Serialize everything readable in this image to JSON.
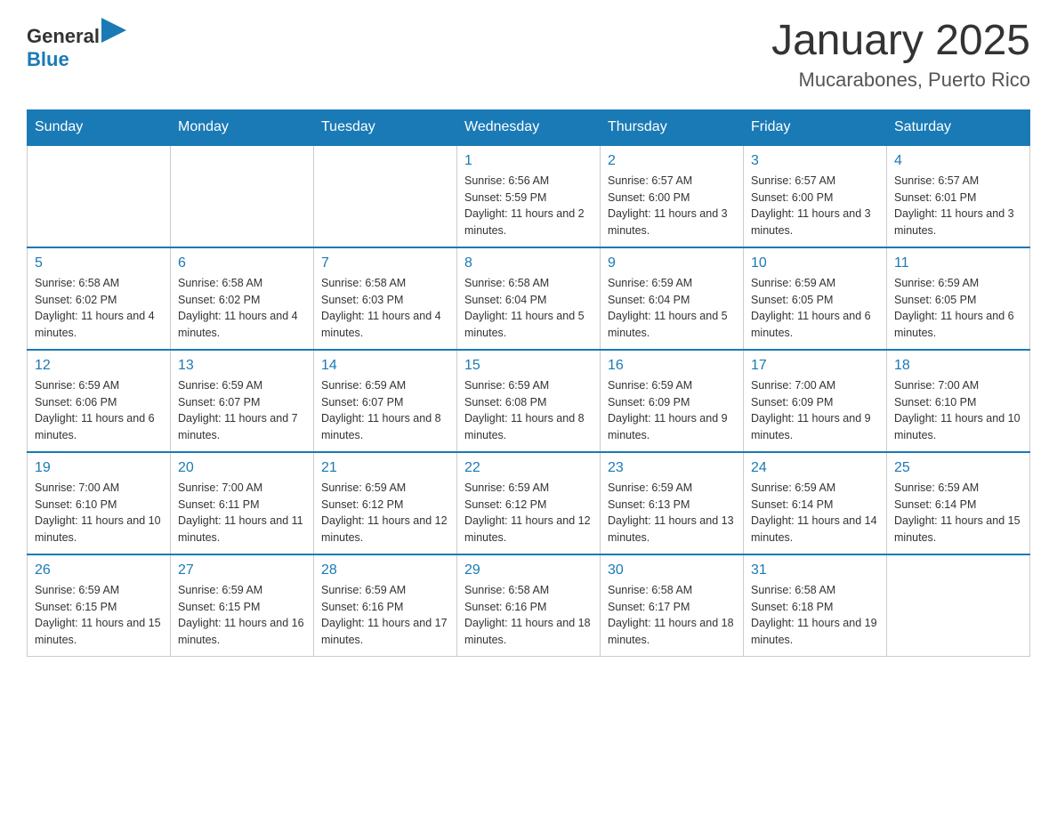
{
  "header": {
    "logo_general": "General",
    "logo_blue": "Blue",
    "month_title": "January 2025",
    "location": "Mucarabones, Puerto Rico"
  },
  "days_of_week": [
    "Sunday",
    "Monday",
    "Tuesday",
    "Wednesday",
    "Thursday",
    "Friday",
    "Saturday"
  ],
  "weeks": [
    [
      {
        "day": "",
        "info": ""
      },
      {
        "day": "",
        "info": ""
      },
      {
        "day": "",
        "info": ""
      },
      {
        "day": "1",
        "info": "Sunrise: 6:56 AM\nSunset: 5:59 PM\nDaylight: 11 hours and 2 minutes."
      },
      {
        "day": "2",
        "info": "Sunrise: 6:57 AM\nSunset: 6:00 PM\nDaylight: 11 hours and 3 minutes."
      },
      {
        "day": "3",
        "info": "Sunrise: 6:57 AM\nSunset: 6:00 PM\nDaylight: 11 hours and 3 minutes."
      },
      {
        "day": "4",
        "info": "Sunrise: 6:57 AM\nSunset: 6:01 PM\nDaylight: 11 hours and 3 minutes."
      }
    ],
    [
      {
        "day": "5",
        "info": "Sunrise: 6:58 AM\nSunset: 6:02 PM\nDaylight: 11 hours and 4 minutes."
      },
      {
        "day": "6",
        "info": "Sunrise: 6:58 AM\nSunset: 6:02 PM\nDaylight: 11 hours and 4 minutes."
      },
      {
        "day": "7",
        "info": "Sunrise: 6:58 AM\nSunset: 6:03 PM\nDaylight: 11 hours and 4 minutes."
      },
      {
        "day": "8",
        "info": "Sunrise: 6:58 AM\nSunset: 6:04 PM\nDaylight: 11 hours and 5 minutes."
      },
      {
        "day": "9",
        "info": "Sunrise: 6:59 AM\nSunset: 6:04 PM\nDaylight: 11 hours and 5 minutes."
      },
      {
        "day": "10",
        "info": "Sunrise: 6:59 AM\nSunset: 6:05 PM\nDaylight: 11 hours and 6 minutes."
      },
      {
        "day": "11",
        "info": "Sunrise: 6:59 AM\nSunset: 6:05 PM\nDaylight: 11 hours and 6 minutes."
      }
    ],
    [
      {
        "day": "12",
        "info": "Sunrise: 6:59 AM\nSunset: 6:06 PM\nDaylight: 11 hours and 6 minutes."
      },
      {
        "day": "13",
        "info": "Sunrise: 6:59 AM\nSunset: 6:07 PM\nDaylight: 11 hours and 7 minutes."
      },
      {
        "day": "14",
        "info": "Sunrise: 6:59 AM\nSunset: 6:07 PM\nDaylight: 11 hours and 8 minutes."
      },
      {
        "day": "15",
        "info": "Sunrise: 6:59 AM\nSunset: 6:08 PM\nDaylight: 11 hours and 8 minutes."
      },
      {
        "day": "16",
        "info": "Sunrise: 6:59 AM\nSunset: 6:09 PM\nDaylight: 11 hours and 9 minutes."
      },
      {
        "day": "17",
        "info": "Sunrise: 7:00 AM\nSunset: 6:09 PM\nDaylight: 11 hours and 9 minutes."
      },
      {
        "day": "18",
        "info": "Sunrise: 7:00 AM\nSunset: 6:10 PM\nDaylight: 11 hours and 10 minutes."
      }
    ],
    [
      {
        "day": "19",
        "info": "Sunrise: 7:00 AM\nSunset: 6:10 PM\nDaylight: 11 hours and 10 minutes."
      },
      {
        "day": "20",
        "info": "Sunrise: 7:00 AM\nSunset: 6:11 PM\nDaylight: 11 hours and 11 minutes."
      },
      {
        "day": "21",
        "info": "Sunrise: 6:59 AM\nSunset: 6:12 PM\nDaylight: 11 hours and 12 minutes."
      },
      {
        "day": "22",
        "info": "Sunrise: 6:59 AM\nSunset: 6:12 PM\nDaylight: 11 hours and 12 minutes."
      },
      {
        "day": "23",
        "info": "Sunrise: 6:59 AM\nSunset: 6:13 PM\nDaylight: 11 hours and 13 minutes."
      },
      {
        "day": "24",
        "info": "Sunrise: 6:59 AM\nSunset: 6:14 PM\nDaylight: 11 hours and 14 minutes."
      },
      {
        "day": "25",
        "info": "Sunrise: 6:59 AM\nSunset: 6:14 PM\nDaylight: 11 hours and 15 minutes."
      }
    ],
    [
      {
        "day": "26",
        "info": "Sunrise: 6:59 AM\nSunset: 6:15 PM\nDaylight: 11 hours and 15 minutes."
      },
      {
        "day": "27",
        "info": "Sunrise: 6:59 AM\nSunset: 6:15 PM\nDaylight: 11 hours and 16 minutes."
      },
      {
        "day": "28",
        "info": "Sunrise: 6:59 AM\nSunset: 6:16 PM\nDaylight: 11 hours and 17 minutes."
      },
      {
        "day": "29",
        "info": "Sunrise: 6:58 AM\nSunset: 6:16 PM\nDaylight: 11 hours and 18 minutes."
      },
      {
        "day": "30",
        "info": "Sunrise: 6:58 AM\nSunset: 6:17 PM\nDaylight: 11 hours and 18 minutes."
      },
      {
        "day": "31",
        "info": "Sunrise: 6:58 AM\nSunset: 6:18 PM\nDaylight: 11 hours and 19 minutes."
      },
      {
        "day": "",
        "info": ""
      }
    ]
  ]
}
